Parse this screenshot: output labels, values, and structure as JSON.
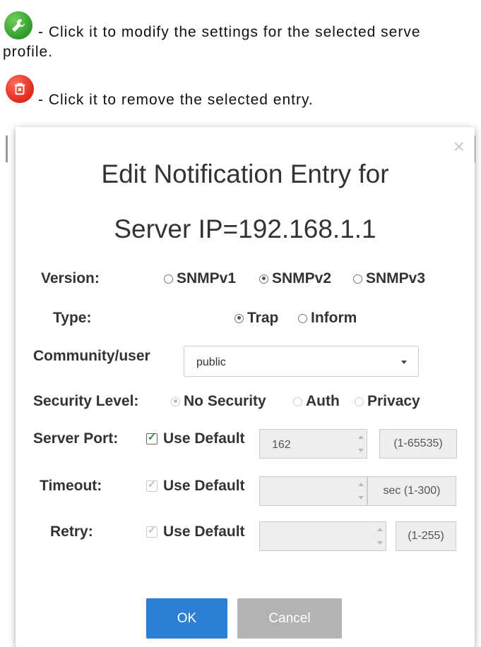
{
  "doc": {
    "edit_line_1": "- Click it to modify the settings for the selected serve",
    "edit_line_2": "profile.",
    "remove_line": "- Click it to remove the selected entry."
  },
  "icons": {
    "edit": "wrench-icon",
    "remove": "trash-icon"
  },
  "modal": {
    "close": "×",
    "title_line_1": "Edit Notification Entry for",
    "title_line_2": "Server IP=192.168.1.1",
    "version": {
      "label": "Version:",
      "options": [
        "SNMPv1",
        "SNMPv2",
        "SNMPv3"
      ],
      "selected": "SNMPv2"
    },
    "type": {
      "label": "Type:",
      "options": [
        "Trap",
        "Inform"
      ],
      "selected": "Trap"
    },
    "community": {
      "label": "Community/user",
      "value": "public"
    },
    "security": {
      "label": "Security Level:",
      "options": [
        "No Security",
        "Auth",
        "Privacy"
      ],
      "selected": "No Security"
    },
    "server_port": {
      "label": "Server Port:",
      "use_default": "Use Default",
      "value": "162",
      "range": "(1-65535)"
    },
    "timeout": {
      "label": "Timeout:",
      "use_default": "Use Default",
      "value": "",
      "range": "sec (1-300)"
    },
    "retry": {
      "label": "Retry:",
      "use_default": "Use Default",
      "value": "",
      "range": "(1-255)"
    },
    "ok": "OK",
    "cancel": "Cancel"
  },
  "colors": {
    "ok": "#2c7fd4",
    "cancel": "#b3b3b3",
    "edit_icon": "#3a9b2e",
    "remove_icon": "#e0291b"
  }
}
